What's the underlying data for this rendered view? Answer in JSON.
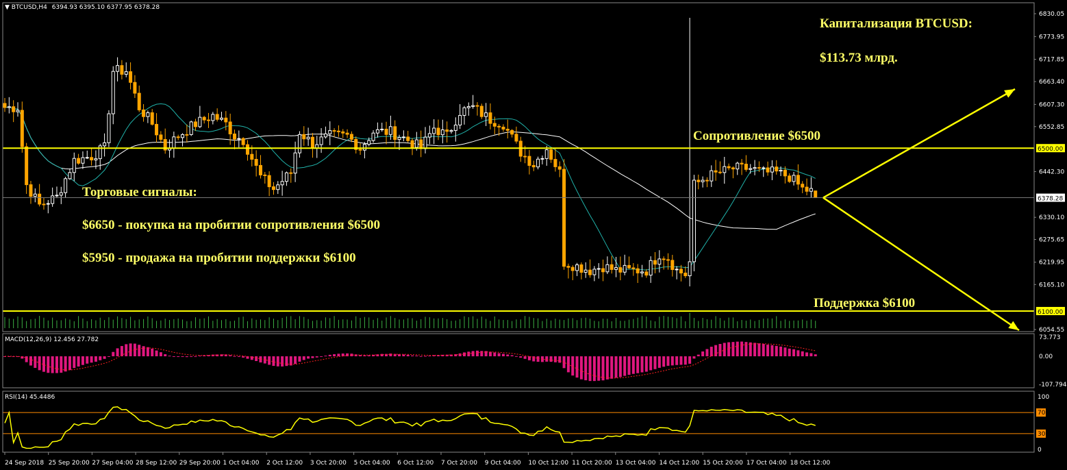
{
  "header": {
    "symbol": "BTCUSD,H4",
    "ohlc": "6394.93 6395.10 6377.95 6378.28",
    "macd_label": "MACD(12,26,9) 12.456 27.782",
    "rsi_label": "RSI(14) 45.4486"
  },
  "annotations": {
    "cap_title": "Капитализация BTCUSD:",
    "cap_value": "$113.73 млрд.",
    "resistance": "Сопротивление $6500",
    "support": "Поддержка $6100",
    "signals_title": "Торговые сигналы:",
    "signal_buy": "$6650 - покупка на пробитии сопротивления $6500",
    "signal_sell": "$5950 - продажа на пробитии поддержки $6100"
  },
  "colors": {
    "background": "#000000",
    "bull": "#ffffff",
    "bear": "#ffa500",
    "level_line": "#ffff00",
    "ma_slow": "#ffffff",
    "ma_fast": "#20b2aa",
    "volume": "#3cb043",
    "macd_hist": "#e0177f",
    "macd_signal": "#ff2020",
    "rsi_line": "#ffff00",
    "rsi_levels": "#ff8c00",
    "annotation_text": "#ffff66",
    "arrow": "#ffff00"
  },
  "chart_data": [
    {
      "type": "candlestick",
      "title": "BTCUSD,H4",
      "ylim": [
        6054.55,
        6830.05
      ],
      "y_tick_labels": [
        "6830.05",
        "6773.95",
        "6717.85",
        "6663.40",
        "6607.30",
        "6552.85",
        "6500.00",
        "6442.30",
        "6378.28",
        "6330.10",
        "6275.65",
        "6219.95",
        "6165.10",
        "6100.00",
        "6054.55"
      ],
      "x_tick_labels": [
        "24 Sep 2018",
        "25 Sep 20:00",
        "27 Sep 04:00",
        "28 Sep 12:00",
        "29 Sep 20:00",
        "1 Oct 04:00",
        "2 Oct 12:00",
        "3 Oct 20:00",
        "5 Oct 04:00",
        "6 Oct 12:00",
        "7 Oct 20:00",
        "9 Oct 04:00",
        "10 Oct 12:00",
        "11 Oct 20:00",
        "13 Oct 04:00",
        "14 Oct 12:00",
        "15 Oct 20:00",
        "17 Oct 04:00",
        "18 Oct 12:00"
      ],
      "horizontal_levels": [
        {
          "value": 6500.0,
          "label": "6500.00"
        },
        {
          "value": 6100.0,
          "label": "6100.00"
        }
      ],
      "current_price": 6378.28,
      "last_candle": {
        "open": 6394.93,
        "high": 6395.1,
        "low": 6377.95,
        "close": 6378.28
      },
      "anchors": [
        [
          0,
          6600
        ],
        [
          3,
          6600
        ],
        [
          5,
          6410
        ],
        [
          8,
          6360
        ],
        [
          12,
          6380
        ],
        [
          16,
          6470
        ],
        [
          20,
          6480
        ],
        [
          23,
          6500
        ],
        [
          25,
          6690
        ],
        [
          28,
          6690
        ],
        [
          31,
          6600
        ],
        [
          34,
          6560
        ],
        [
          37,
          6500
        ],
        [
          40,
          6530
        ],
        [
          44,
          6560
        ],
        [
          48,
          6580
        ],
        [
          51,
          6560
        ],
        [
          53,
          6530
        ],
        [
          55,
          6520
        ],
        [
          59,
          6430
        ],
        [
          62,
          6400
        ],
        [
          66,
          6440
        ],
        [
          68,
          6540
        ],
        [
          71,
          6510
        ],
        [
          75,
          6530
        ],
        [
          79,
          6530
        ],
        [
          82,
          6500
        ],
        [
          85,
          6540
        ],
        [
          89,
          6540
        ],
        [
          93,
          6520
        ],
        [
          96,
          6500
        ],
        [
          99,
          6550
        ],
        [
          102,
          6530
        ],
        [
          105,
          6590
        ],
        [
          108,
          6600
        ],
        [
          112,
          6570
        ],
        [
          115,
          6560
        ],
        [
          119,
          6490
        ],
        [
          122,
          6460
        ],
        [
          125,
          6500
        ],
        [
          128,
          6440
        ],
        [
          129,
          6220
        ],
        [
          132,
          6210
        ],
        [
          135,
          6200
        ],
        [
          138,
          6210
        ],
        [
          141,
          6200
        ],
        [
          145,
          6200
        ],
        [
          148,
          6200
        ],
        [
          151,
          6240
        ],
        [
          153,
          6230
        ],
        [
          155,
          6200
        ],
        [
          157,
          6190
        ],
        [
          158,
          6220
        ],
        [
          159,
          6410
        ],
        [
          162,
          6430
        ],
        [
          165,
          6440
        ],
        [
          168,
          6450
        ],
        [
          172,
          6450
        ],
        [
          175,
          6440
        ],
        [
          178,
          6440
        ],
        [
          181,
          6430
        ],
        [
          184,
          6400
        ],
        [
          186,
          6394
        ],
        [
          187,
          6378.28
        ]
      ],
      "spikes": [
        {
          "bar": 158,
          "high": 6820
        }
      ],
      "series": [
        {
          "name": "",
          "type": "moving-average"
        },
        {
          "name": "",
          "type": "moving-average"
        },
        {
          "name": "",
          "type": "volume"
        }
      ]
    },
    {
      "type": "bar",
      "title": "MACD(12,26,9) 12.456 27.782",
      "values_info": {
        "macd": 12.456,
        "signal": 27.782
      },
      "ylim": [
        -107.794,
        73.773
      ],
      "y_tick_labels": [
        "73.773",
        "0.00",
        "-107.794"
      ]
    },
    {
      "type": "line",
      "title": "RSI(14) 45.4486",
      "value": 45.4486,
      "ylim": [
        0,
        100
      ],
      "y_tick_labels": [
        "100",
        "70",
        "30",
        "0"
      ],
      "levels": [
        70,
        30
      ]
    }
  ]
}
